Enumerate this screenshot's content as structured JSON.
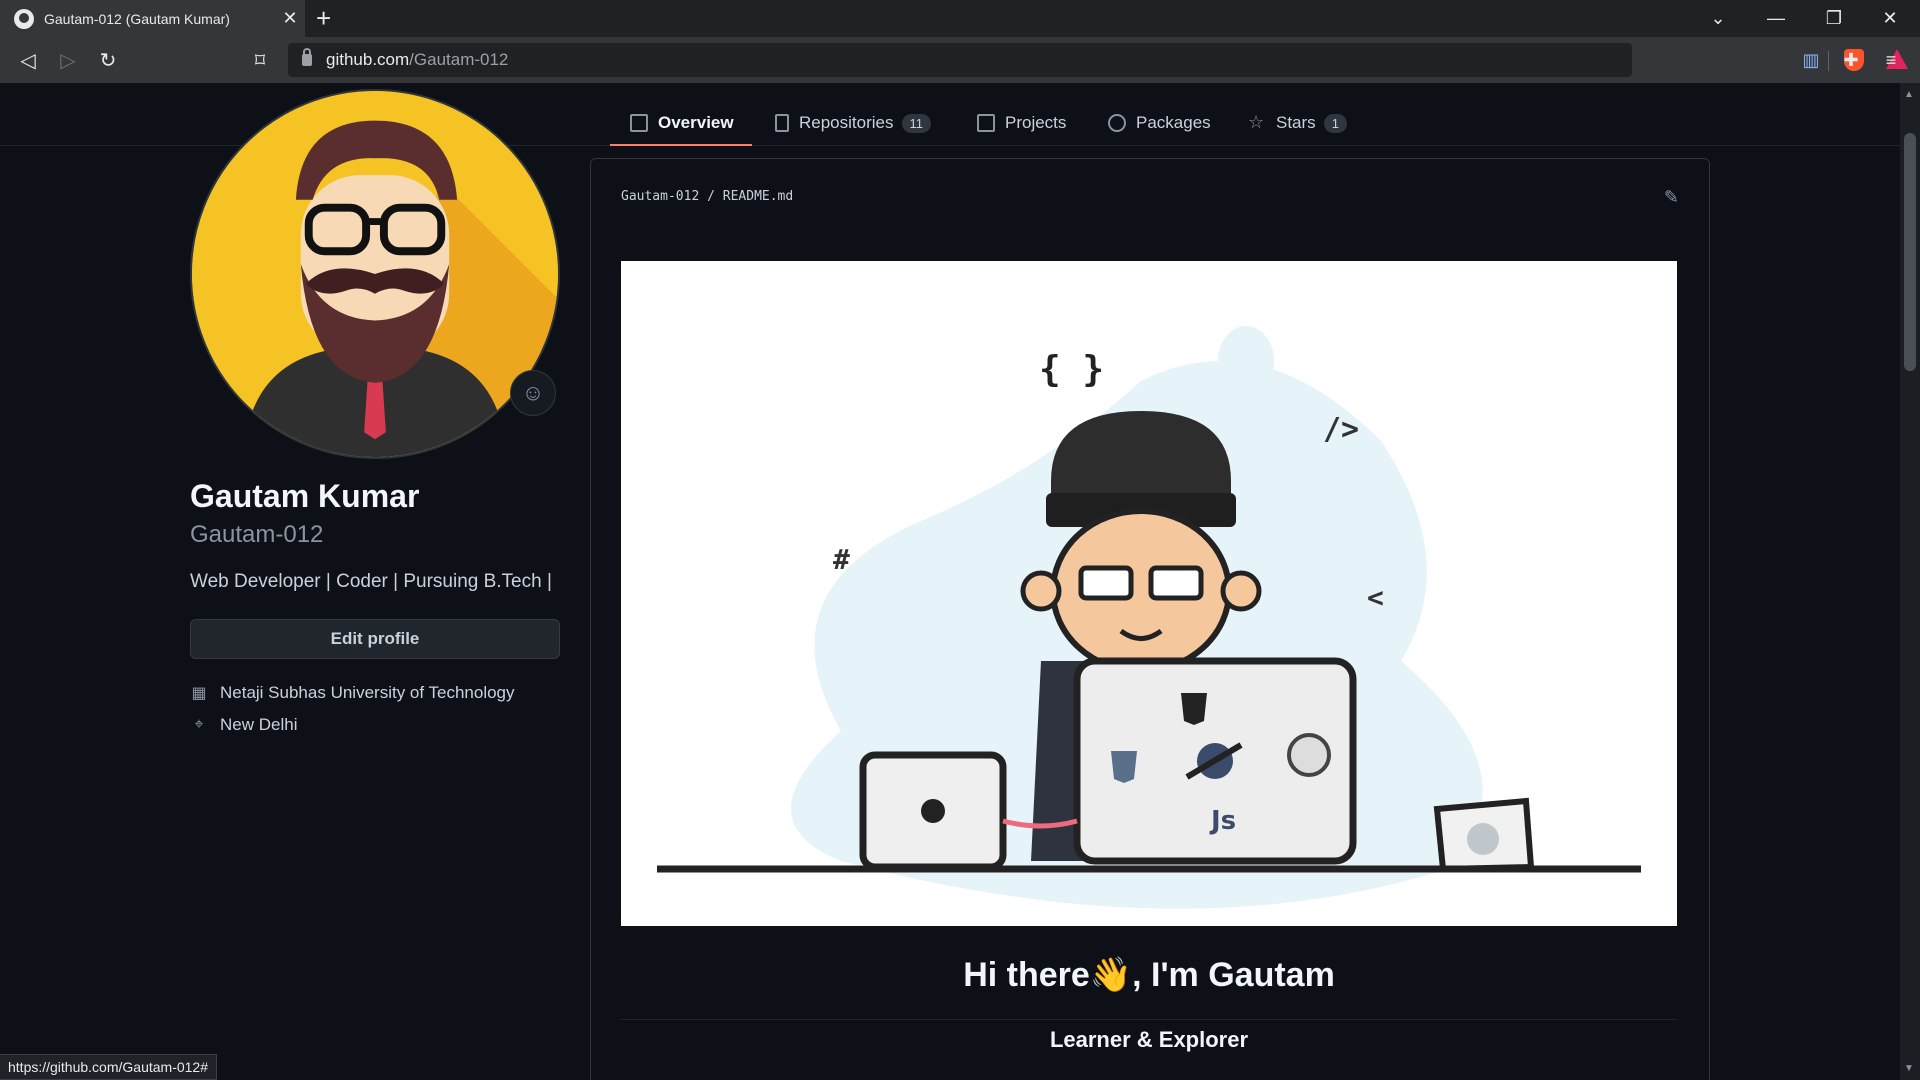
{
  "browser": {
    "tab_title": "Gautam-012 (Gautam Kumar)",
    "tab_close": "✕",
    "new_tab": "+",
    "url_host": "github.com",
    "url_path": "/Gautam-012",
    "status_url": "https://github.com/Gautam-012#"
  },
  "profile_nav": {
    "tabs": [
      {
        "label": "Overview",
        "icon": "book-icon"
      },
      {
        "label": "Repositories",
        "icon": "repo-icon",
        "count": "11"
      },
      {
        "label": "Projects",
        "icon": "table-icon"
      },
      {
        "label": "Packages",
        "icon": "package-icon"
      },
      {
        "label": "Stars",
        "icon": "star-icon",
        "count": "1"
      }
    ]
  },
  "profile": {
    "name": "Gautam Kumar",
    "login": "Gautam-012",
    "bio": "Web Developer | Coder | Pursuing B.Tech |",
    "edit_label": "Edit profile",
    "organization": "Netaji Subhas University of Technology",
    "location": "New Delhi"
  },
  "readme": {
    "owner": "Gautam-012",
    "separator": "/",
    "file": "README.md",
    "banner_symbols": {
      "braces": "{ }",
      "tag": "/>",
      "hash": "#",
      "lt": "<",
      "js": "Js"
    },
    "heading": "Hi there👋, I'm Gautam",
    "subheading": "Learner & Explorer"
  },
  "colors": {
    "page_bg": "#0d1117",
    "accent_underline": "#f78166",
    "avatar_bg": "#f6c324"
  }
}
